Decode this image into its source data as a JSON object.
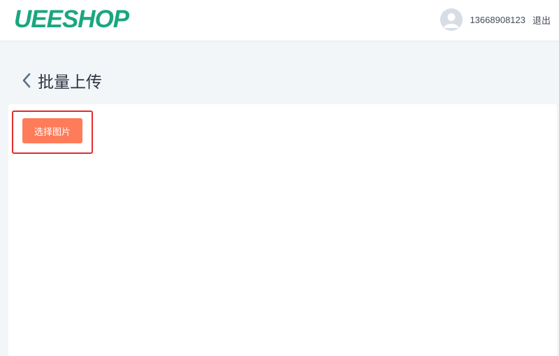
{
  "header": {
    "logo_text": "UEESHOP",
    "user_phone": "13668908123",
    "logout_label": "退出",
    "avatar_icon": "user-avatar-icon"
  },
  "page": {
    "back_icon": "chevron-left-icon",
    "title": "批量上传"
  },
  "upload": {
    "select_button_label": "选择图片"
  },
  "colors": {
    "brand": "#1aa67f",
    "button": "#fe7c5a",
    "highlight_border": "#e52b2b",
    "page_background": "#f3f6f9"
  }
}
